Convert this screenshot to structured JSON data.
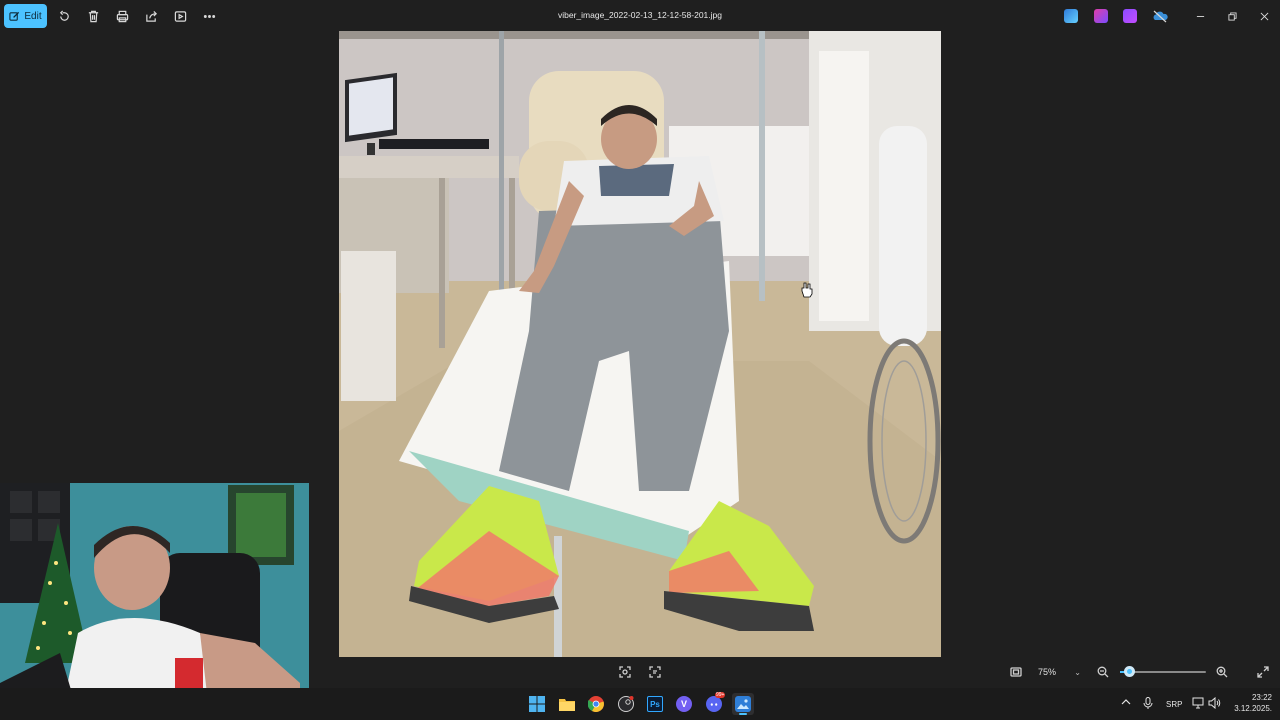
{
  "titlebar": {
    "edit_label": "Edit",
    "file_name": "viber_image_2022-02-13_12-12-58-201.jpg",
    "icons": [
      "rotate-icon",
      "delete-icon",
      "print-icon",
      "share-icon",
      "slideshow-icon",
      "more-icon"
    ],
    "app_badges": [
      "designer-icon",
      "clipchamp-icon",
      "video-editor-icon",
      "onedrive-icon"
    ]
  },
  "bottombar": {
    "zoom_value": "75%",
    "zoom_fraction": 0.1
  },
  "taskbar": {
    "apps": [
      "start-icon",
      "file-explorer-icon",
      "chrome-icon",
      "steam-icon",
      "photoshop-icon",
      "viber-icon",
      "discord-icon",
      "photos-app-icon"
    ],
    "photoshop_label": "Ps",
    "viber_label": "V",
    "discord_badge": "99+",
    "language": "SRP",
    "time": "23:22",
    "date": "3.12.2025."
  },
  "colors": {
    "accent": "#4cc2ff",
    "background": "#1f1f1f",
    "taskbar": "#1b1b1b"
  }
}
